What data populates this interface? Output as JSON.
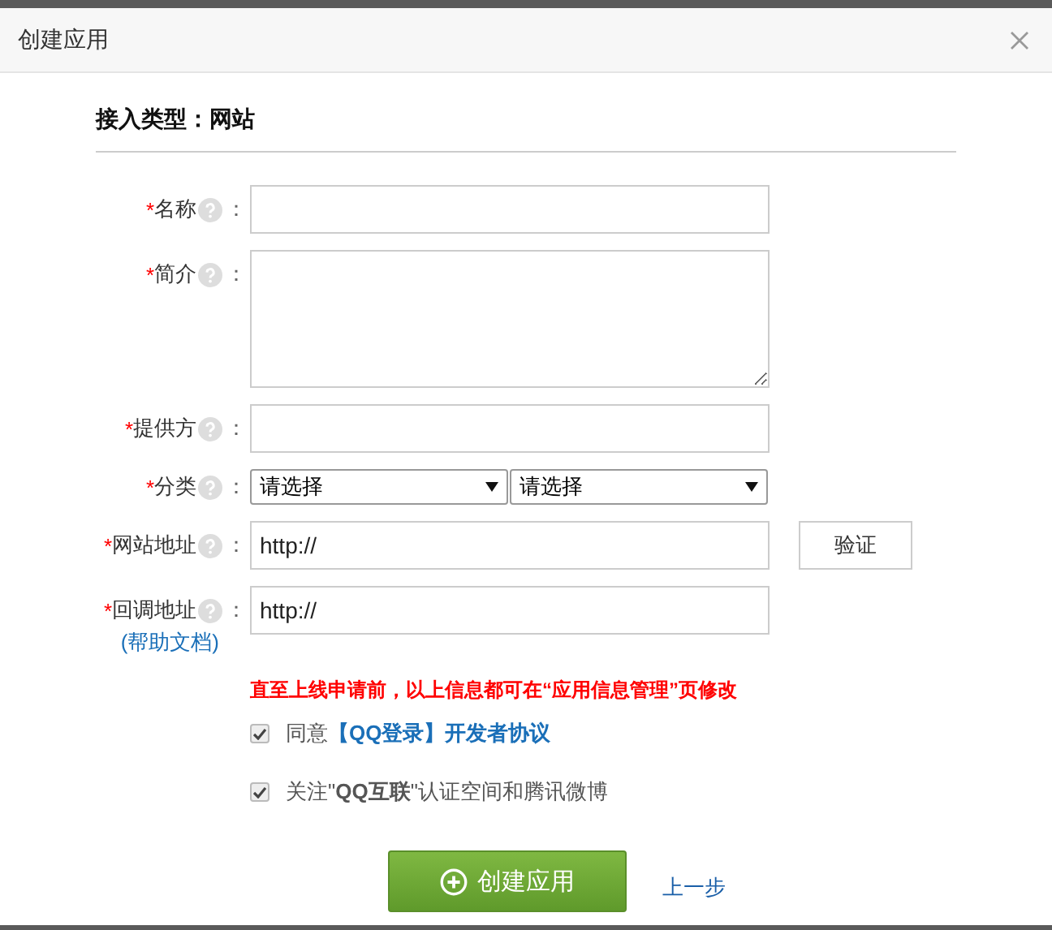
{
  "dialog": {
    "title": "创建应用"
  },
  "section_title": "接入类型：网站",
  "fields": [
    {
      "kind": "text",
      "required_mark": "*",
      "label": "名称",
      "colon": "："
    },
    {
      "kind": "textarea",
      "required_mark": "*",
      "label": "简介",
      "colon": "："
    },
    {
      "kind": "text",
      "required_mark": "*",
      "label": "提供方",
      "colon": "："
    },
    {
      "kind": "select",
      "required_mark": "*",
      "label": "分类",
      "colon": "：",
      "selects": [
        "请选择",
        "请选择"
      ]
    },
    {
      "kind": "text",
      "required_mark": "*",
      "label": "网站地址",
      "colon": "：",
      "value": "http://",
      "button": "验证"
    },
    {
      "kind": "text",
      "required_mark": "*",
      "label": "回调地址",
      "colon": "：",
      "value": "http://",
      "link": "(帮助文档)"
    }
  ],
  "note": "直至上线申请前，以上信息都可在“应用信息管理”页修改",
  "agreements": [
    {
      "kind": "link",
      "text": "同意",
      "link": "【QQ登录】开发者协议",
      "checked": true
    },
    {
      "kind": "plain",
      "text": "关注\"**QQ互联**\"认证空间和腾讯微博",
      "checked": true
    }
  ],
  "buttons": {
    "primary": "创建应用",
    "back": "上一步"
  }
}
